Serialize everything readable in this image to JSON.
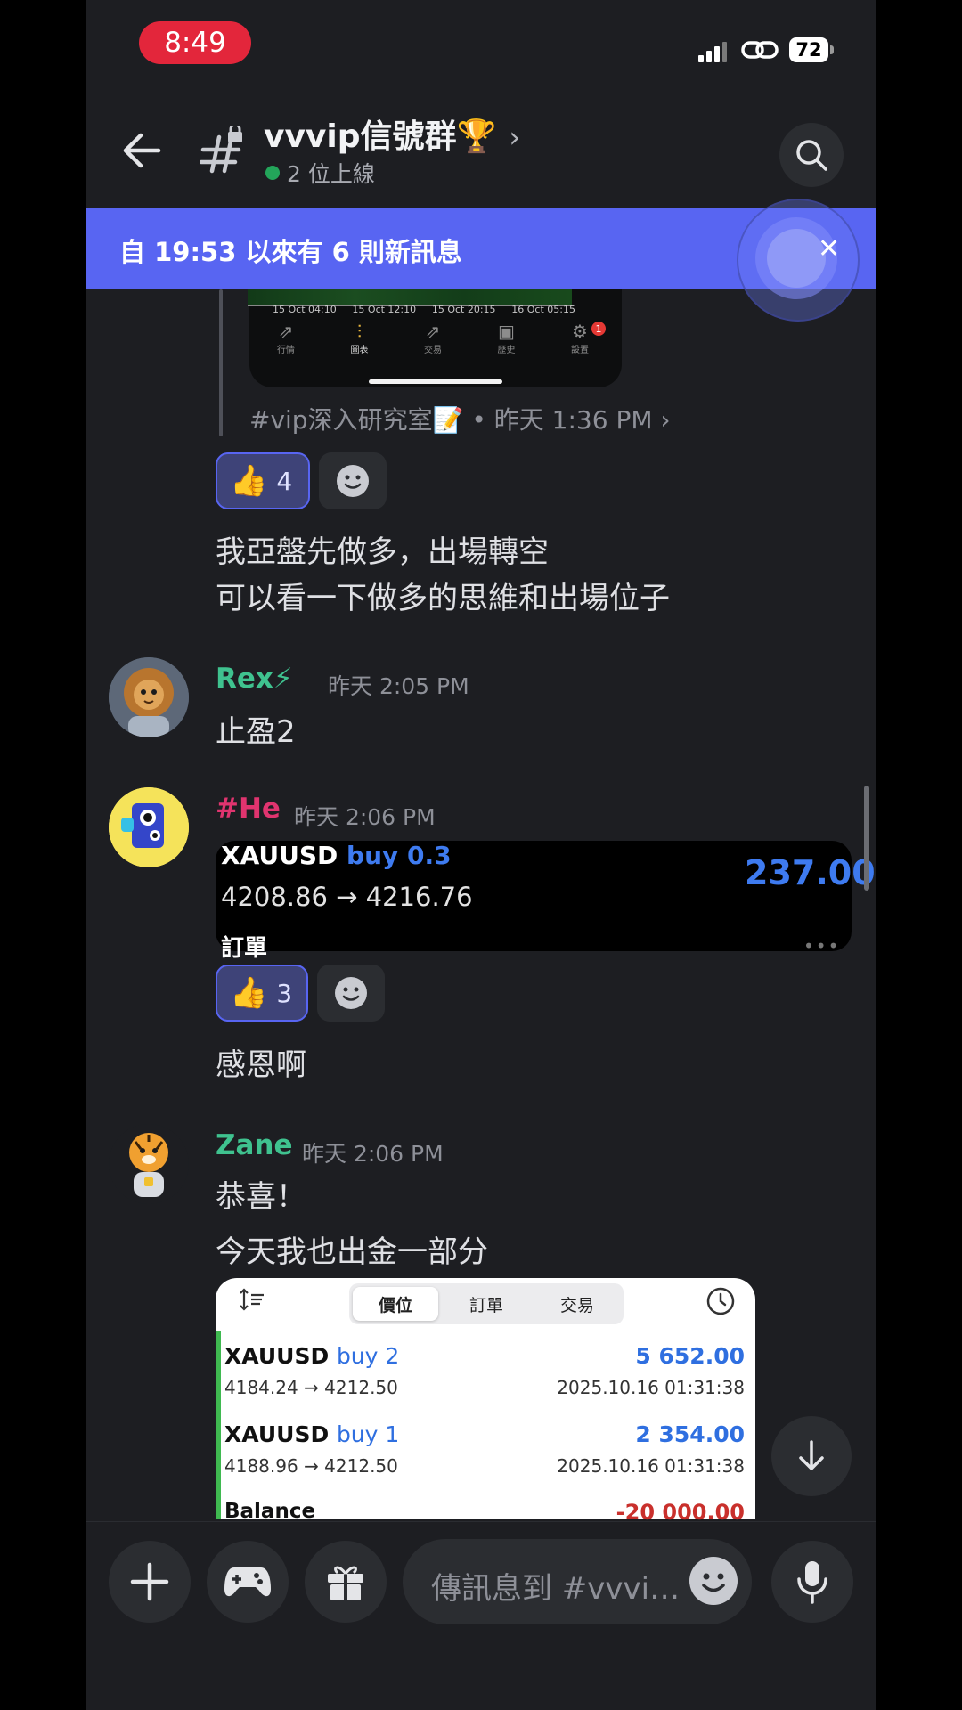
{
  "status_bar": {
    "time": "8:49",
    "battery": "72"
  },
  "header": {
    "channel_name": "vvvip信號群🏆",
    "chevron": "›",
    "online": "2 位上線"
  },
  "banner": {
    "text": "自 19:53 以來有 6 則新訊息",
    "close": "✕"
  },
  "chart_preview": {
    "dates": [
      "15 Oct 04:10",
      "15 Oct 12:10",
      "15 Oct 20:15",
      "16 Oct 05:15"
    ],
    "tabs": [
      {
        "icon": "⇗",
        "label": "行情"
      },
      {
        "icon": "⫶",
        "label": "圖表"
      },
      {
        "icon": "⇗",
        "label": "交易"
      },
      {
        "icon": "▣",
        "label": "歷史"
      },
      {
        "icon": "⚙",
        "label": "設置"
      }
    ],
    "badge": "1"
  },
  "source_line": "#vip深入研究室📝 • 昨天 1:36 PM  ›",
  "messages": {
    "first_reaction": {
      "emoji": "👍",
      "count": "4"
    },
    "first_text_1": "我亞盤先做多，出場轉空",
    "first_text_2": "可以看一下做多的思維和出場位子",
    "rex": {
      "name": "Rex⚡",
      "time": "昨天 2:05 PM",
      "text": "止盈2",
      "name_color": "#3fc28f"
    },
    "he": {
      "name": "#He",
      "time": "昨天 2:06 PM",
      "name_color": "#e0346f",
      "embed_symbol": "XAUUSD",
      "embed_side": "buy 0.3",
      "embed_prices": "4208.86 → 4216.76",
      "embed_profit": "237.00",
      "embed_footer": "訂單",
      "reaction": {
        "emoji": "👍",
        "count": "3"
      },
      "text": "感恩啊"
    },
    "zane": {
      "name": "Zane",
      "time": "昨天 2:06 PM",
      "name_color": "#3fc28f",
      "text_1": "恭喜！",
      "text_2": "今天我也出金一部分",
      "trade_tabs": [
        "價位",
        "訂單",
        "交易"
      ],
      "trades": [
        {
          "symbol": "XAUUSD",
          "side": "buy 2",
          "prices": "4184.24 → 4212.50",
          "profit": "5 652.00",
          "date": "2025.10.16 01:31:38"
        },
        {
          "symbol": "XAUUSD",
          "side": "buy 1",
          "prices": "4188.96 → 4212.50",
          "profit": "2 354.00",
          "date": "2025.10.16 01:31:38"
        }
      ],
      "balance_label": "Balance",
      "balance_value": "-20 000.00"
    }
  },
  "composer": {
    "placeholder": "傳訊息到 #vvvi…"
  }
}
